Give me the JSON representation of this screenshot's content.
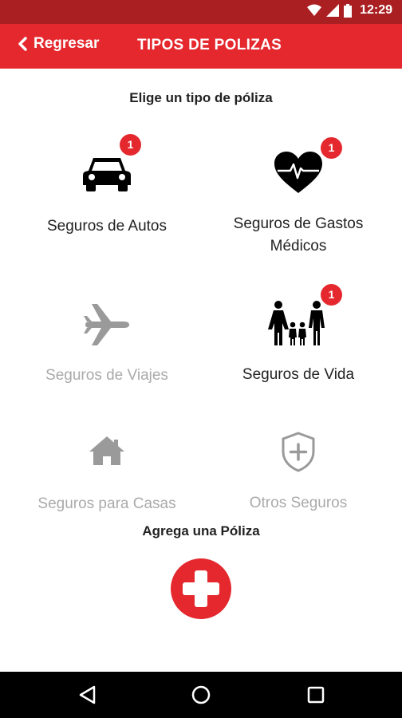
{
  "status_bar": {
    "time": "12:29",
    "icons": [
      "wifi-icon",
      "cell-signal-icon",
      "battery-icon"
    ],
    "background_color": "#aa1f22"
  },
  "app_bar": {
    "back_label": "Regresar",
    "title": "TIPOS DE POLIZAS",
    "background_color": "#e4282e"
  },
  "subtitle": "Elige un tipo de póliza",
  "policy_types": [
    {
      "label": "Seguros de Autos",
      "icon": "car-icon",
      "badge": "1",
      "enabled": true
    },
    {
      "label": "Seguros de Gastos Médicos",
      "icon": "heart-pulse-icon",
      "badge": "1",
      "enabled": true
    },
    {
      "label": "Seguros de Viajes",
      "icon": "airplane-icon",
      "badge": "",
      "enabled": false
    },
    {
      "label": "Seguros de Vida",
      "icon": "family-icon",
      "badge": "1",
      "enabled": true
    },
    {
      "label": "Seguros para Casas",
      "icon": "house-icon",
      "badge": "",
      "enabled": false
    },
    {
      "label": "Otros Seguros",
      "icon": "shield-plus-icon",
      "badge": "",
      "enabled": false
    }
  ],
  "add_policy": {
    "title": "Agrega una Póliza",
    "icon": "plus-icon",
    "color": "#e4282e"
  },
  "nav_bar": {
    "icons": [
      "back-triangle-icon",
      "home-circle-icon",
      "recents-square-icon"
    ]
  },
  "colors": {
    "accent": "#e4282e",
    "disabled": "#aaaaaa",
    "text": "#222222"
  }
}
